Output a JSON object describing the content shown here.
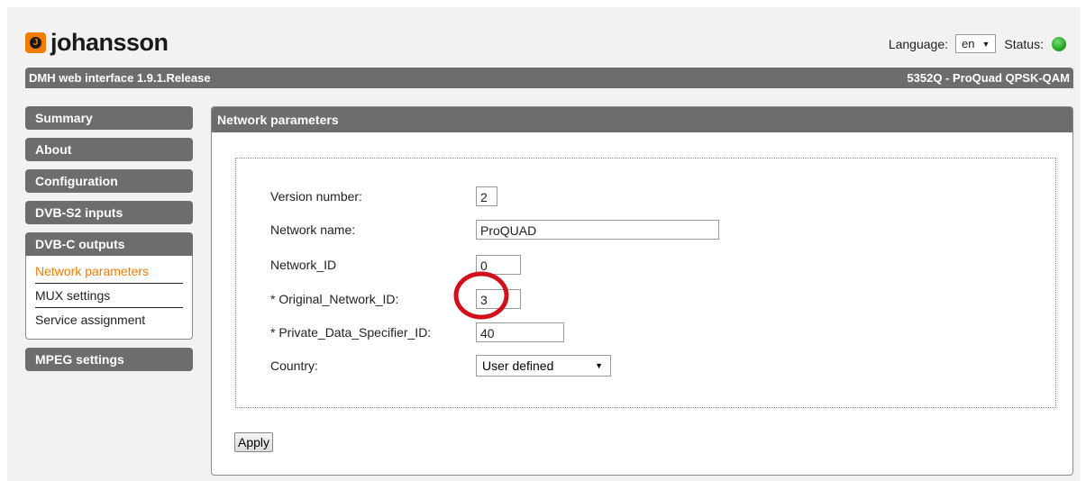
{
  "header": {
    "logo_mark": "J",
    "logo_text": "johansson",
    "language_label": "Language:",
    "language_value": "en",
    "status_label": "Status:",
    "status_color": "#2fb82f"
  },
  "titlebar": {
    "left": "DMH web interface 1.9.1.Release",
    "right": "5352Q - ProQuad QPSK-QAM"
  },
  "sidebar": {
    "items": [
      {
        "label": "Summary"
      },
      {
        "label": "About"
      },
      {
        "label": "Configuration"
      },
      {
        "label": "DVB-S2 inputs"
      },
      {
        "label": "DVB-C outputs"
      },
      {
        "label": "MPEG settings"
      }
    ],
    "subitems": [
      {
        "label": "Network parameters"
      },
      {
        "label": "MUX settings"
      },
      {
        "label": "Service assignment"
      }
    ]
  },
  "panel": {
    "title": "Network parameters",
    "fields": {
      "version_label": "Version number:",
      "version_value": "2",
      "network_name_label": "Network name:",
      "network_name_value": "ProQUAD",
      "network_id_label": "Network_ID",
      "network_id_value": "0",
      "original_network_id_label": "* Original_Network_ID:",
      "original_network_id_value": "3",
      "private_data_label": "* Private_Data_Specifier_ID:",
      "private_data_value": "40",
      "country_label": "Country:",
      "country_value": "User defined"
    },
    "apply_label": "Apply"
  },
  "colors": {
    "accent": "#f07d00",
    "bar": "#6d6d6d",
    "annotation": "#d0101a"
  }
}
